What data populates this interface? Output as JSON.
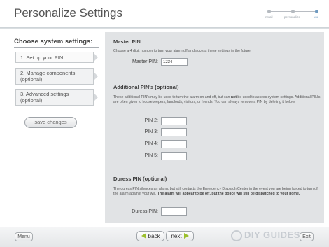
{
  "header": {
    "title": "Personalize Settings",
    "steps": [
      {
        "label": "install",
        "active": false
      },
      {
        "label": "personalize",
        "active": false
      },
      {
        "label": "use",
        "active": true
      }
    ]
  },
  "sidebar": {
    "heading": "Choose system settings:",
    "items": [
      {
        "label": "1. Set up your PIN",
        "active": true
      },
      {
        "label": "2. Manage components (optional)",
        "active": false
      },
      {
        "label": "3. Advanced settings (optional)",
        "active": false
      }
    ],
    "save_label": "save changes"
  },
  "master_pin": {
    "title": "Master PIN",
    "description": "Choose a 4 digit number to turn your alarm off and access these settings in the future.",
    "label": "Master PIN:",
    "value": "1234"
  },
  "additional_pins": {
    "title": "Additional PIN's (optional)",
    "description_a": "These additional PIN's may be used to turn the alarm on and off, but can ",
    "description_b": "not",
    "description_c": " be used to access system settings.  Additional PIN's are often given to housekeepers, landlords, visitors, or friends.  You can always remove a PIN by deleting it below.",
    "fields": [
      {
        "label": "PIN 2:",
        "value": ""
      },
      {
        "label": "PIN 3:",
        "value": ""
      },
      {
        "label": "PIN 4:",
        "value": ""
      },
      {
        "label": "PIN 5:",
        "value": ""
      }
    ]
  },
  "duress_pin": {
    "title": "Duress PIN (optional)",
    "description_a": "The duress PIN silences an alarm, but still contacts the Emergency Dispatch Center in the event you are being forced to turn off the alarm against your will.  ",
    "description_b": "The alarm will appear to be off, but the police will still be dispatched to your home.",
    "label": "Duress PIN:",
    "value": ""
  },
  "footer": {
    "menu_label": "Menu",
    "back_label": "back",
    "next_label": "next",
    "exit_label": "Exit",
    "watermark": "DIY GUIDES"
  },
  "colors": {
    "accent_arrow": "#9bbf2d",
    "active_step": "#6f9bc1",
    "panel_bg": "#e1e3e5"
  }
}
